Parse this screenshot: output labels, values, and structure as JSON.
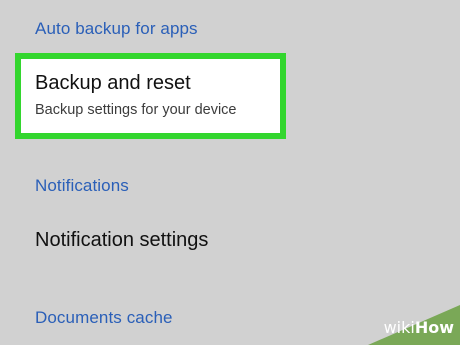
{
  "sections": {
    "auto_backup": {
      "header": "Auto backup for apps"
    },
    "backup": {
      "title": "Backup and reset",
      "subtitle": "Backup settings for your device"
    },
    "notifications": {
      "header": "Notifications",
      "item": "Notification settings"
    },
    "documents": {
      "header": "Documents cache"
    }
  },
  "colors": {
    "background": "#d1d1d1",
    "section_header": "#2a5fb8",
    "highlight_border": "#33d62e"
  },
  "watermark": {
    "wiki": "wiki",
    "how": "How"
  }
}
